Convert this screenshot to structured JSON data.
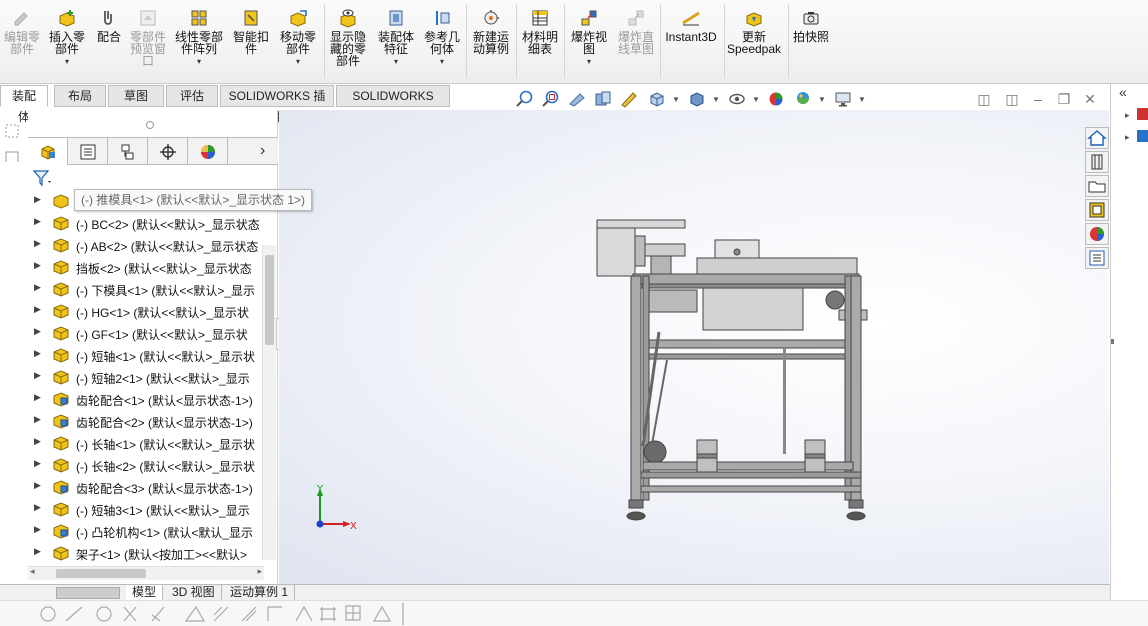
{
  "ribbon": {
    "buttons": [
      {
        "id": "edit-component",
        "label": "编辑零\n部件",
        "disabled": true,
        "icon": "edit-component-icon"
      },
      {
        "id": "insert-component",
        "label": "插入零\n部件",
        "disabled": false,
        "icon": "insert-component-icon",
        "dropdown": true
      },
      {
        "id": "mate",
        "label": "配合",
        "disabled": false,
        "icon": "mate-icon"
      },
      {
        "id": "component-preview",
        "label": "零部件\n预览窗\n口",
        "disabled": true,
        "icon": "preview-window-icon"
      },
      {
        "id": "linear-pattern",
        "label": "线性零部\n件阵列",
        "disabled": false,
        "icon": "linear-pattern-icon",
        "dropdown": true
      },
      {
        "id": "smart-fasteners",
        "label": "智能扣\n件",
        "disabled": false,
        "icon": "smart-fastener-icon"
      },
      {
        "id": "move-component",
        "label": "移动零\n部件",
        "disabled": false,
        "icon": "move-component-icon",
        "dropdown": true
      },
      {
        "id": "show-hidden",
        "label": "显示隐\n藏的零\n部件",
        "disabled": false,
        "icon": "show-hidden-icon"
      },
      {
        "id": "assembly-features",
        "label": "装配体\n特征",
        "disabled": false,
        "icon": "assembly-feature-icon",
        "dropdown": true
      },
      {
        "id": "reference-geometry",
        "label": "参考几\n何体",
        "disabled": false,
        "icon": "reference-geometry-icon",
        "dropdown": true
      },
      {
        "id": "new-motion-study",
        "label": "新建运\n动算例",
        "disabled": false,
        "icon": "motion-study-icon"
      },
      {
        "id": "bom",
        "label": "材料明\n细表",
        "disabled": false,
        "icon": "bom-icon"
      },
      {
        "id": "exploded-view",
        "label": "爆炸视\n图",
        "disabled": false,
        "icon": "exploded-view-icon",
        "dropdown": true
      },
      {
        "id": "explode-line-sketch",
        "label": "爆炸直\n线草图",
        "disabled": true,
        "icon": "explode-line-icon"
      },
      {
        "id": "instant3d",
        "label": "Instant3D",
        "disabled": false,
        "icon": "instant3d-icon"
      },
      {
        "id": "update-speedpak",
        "label": "更新\nSpeedpak",
        "disabled": false,
        "icon": "speedpak-icon"
      },
      {
        "id": "snapshot",
        "label": "拍快照",
        "disabled": false,
        "icon": "camera-icon"
      }
    ]
  },
  "command_tabs": [
    "装配体",
    "布局",
    "草图",
    "评估",
    "SOLIDWORKS 插件",
    "SOLIDWORKS MBD"
  ],
  "tooltip": "(-) 推模具<1> (默认<<默认>_显示状态 1>)",
  "tree": {
    "items": [
      {
        "text": "(-) BC<2> (默认<<默认>_显示状态",
        "type": "part"
      },
      {
        "text": "(-) AB<2> (默认<<默认>_显示状态",
        "type": "part"
      },
      {
        "text": "挡板<2> (默认<<默认>_显示状态",
        "type": "part"
      },
      {
        "text": "(-) 下模具<1> (默认<<默认>_显示",
        "type": "part"
      },
      {
        "text": "(-) HG<1> (默认<<默认>_显示状",
        "type": "part"
      },
      {
        "text": "(-) GF<1> (默认<<默认>_显示状",
        "type": "part"
      },
      {
        "text": "(-) 短轴<1> (默认<<默认>_显示状",
        "type": "part"
      },
      {
        "text": "(-) 短轴2<1> (默认<<默认>_显示",
        "type": "part"
      },
      {
        "text": "齿轮配合<1> (默认<显示状态-1>)",
        "type": "assembly"
      },
      {
        "text": "齿轮配合<2> (默认<显示状态-1>)",
        "type": "assembly"
      },
      {
        "text": "(-) 长轴<1> (默认<<默认>_显示状",
        "type": "part"
      },
      {
        "text": "(-) 长轴<2> (默认<<默认>_显示状",
        "type": "part"
      },
      {
        "text": "齿轮配合<3> (默认<显示状态-1>)",
        "type": "assembly"
      },
      {
        "text": "(-) 短轴3<1> (默认<<默认>_显示",
        "type": "part"
      },
      {
        "text": "(-) 凸轮机构<1> (默认<默认_显示",
        "type": "assembly"
      },
      {
        "text": "架子<1> (默认<按加工><<默认>",
        "type": "part"
      }
    ]
  },
  "bottom_tabs": [
    "模型",
    "3D 视图",
    "运动算例 1"
  ],
  "triad": {
    "x_label": "X",
    "y_label": "Y"
  },
  "colors": {
    "part_icon": "#f0c419",
    "assembly_icon": "#f0c419",
    "accent": "#1e5fb3",
    "triad_x": "#d42020",
    "triad_y": "#1a9a1a",
    "triad_z": "#1f3fd0"
  }
}
